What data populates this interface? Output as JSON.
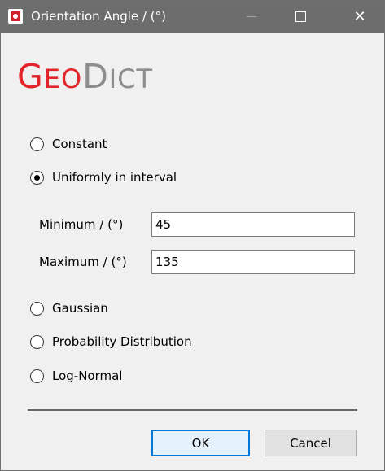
{
  "window": {
    "title": "Orientation Angle / (°)",
    "controls": {
      "minimize": "—",
      "maximize": "☐",
      "close": "✕"
    }
  },
  "logo": {
    "geo_first": "G",
    "geo_rest": "EO",
    "dict_first": "D",
    "dict_rest": "ICT",
    "colors": {
      "geo": "#e3242b",
      "dict": "#8d8d8d"
    }
  },
  "options": [
    {
      "label": "Constant",
      "checked": false
    },
    {
      "label": "Uniformly in interval",
      "checked": true
    },
    {
      "label": "Gaussian",
      "checked": false
    },
    {
      "label": "Probability Distribution",
      "checked": false
    },
    {
      "label": "Log-Normal",
      "checked": false
    }
  ],
  "interval": {
    "minimum_label": "Minimum / (°)",
    "minimum_value": "45",
    "maximum_label": "Maximum / (°)",
    "maximum_value": "135"
  },
  "buttons": {
    "ok": "OK",
    "cancel": "Cancel"
  },
  "colors": {
    "accent": "#0078d7",
    "titlebar": "#6d6d6d"
  }
}
